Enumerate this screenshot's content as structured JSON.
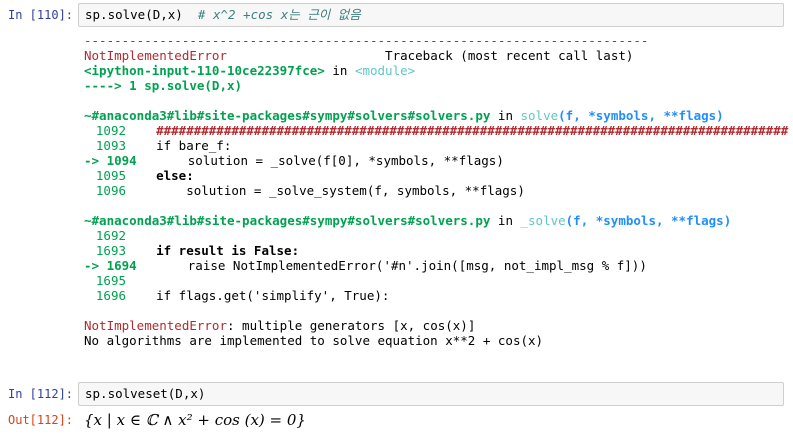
{
  "cells": [
    {
      "in_prompt": "In [110]:",
      "code": "sp.solve(D,x)",
      "comment": "# x^2 +cos x는 근이 없음",
      "traceback": {
        "separator": "---------------------------------------------------------------------------",
        "error_name": "NotImplementedError",
        "header_right": "Traceback (most recent call last)",
        "input_ref": "<ipython-input-110-10ce22397fce>",
        "input_ref_in": " in ",
        "input_ref_module": "<module>",
        "arrow_line": "----> 1 sp.solve(D,x)",
        "frames": [
          {
            "path": "~#anaconda3#lib#site-packages#sympy#solvers#solvers.py",
            "in": " in ",
            "func": "solve",
            "sig": "(f, *symbols, **flags)",
            "lines": [
              {
                "no": "1092",
                "arrow": "",
                "code": "    ####################################################################################"
              },
              {
                "no": "1093",
                "arrow": "",
                "code": "    if bare_f:"
              },
              {
                "no": "1094",
                "arrow": "-> ",
                "code": "        solution = _solve(f[0], *symbols, **flags)"
              },
              {
                "no": "1095",
                "arrow": "",
                "code": "    else:"
              },
              {
                "no": "1096",
                "arrow": "",
                "code": "        solution = _solve_system(f, symbols, **flags)"
              }
            ]
          },
          {
            "path": "~#anaconda3#lib#site-packages#sympy#solvers#solvers.py",
            "in": " in ",
            "func": "_solve",
            "sig": "(f, *symbols, **flags)",
            "lines": [
              {
                "no": "1692",
                "arrow": "",
                "code": ""
              },
              {
                "no": "1693",
                "arrow": "",
                "code": "    if result is False:"
              },
              {
                "no": "1694",
                "arrow": "-> ",
                "code": "        raise NotImplementedError('#n'.join([msg, not_impl_msg % f]))"
              },
              {
                "no": "1695",
                "arrow": "",
                "code": ""
              },
              {
                "no": "1696",
                "arrow": "",
                "code": "    if flags.get('simplify', True):"
              }
            ]
          }
        ],
        "final_error_name": "NotImplementedError",
        "final_error_msg": ": multiple generators [x, cos(x)]",
        "final_error_msg2": "No algorithms are implemented to solve equation x**2 + cos(x)"
      }
    },
    {
      "in_prompt": "In [112]:",
      "code": "sp.solveset(D,x)",
      "out_prompt": "Out[112]:",
      "output_math": "{x | x ∈ ℂ ∧ x² + cos (x) = 0}"
    }
  ]
}
